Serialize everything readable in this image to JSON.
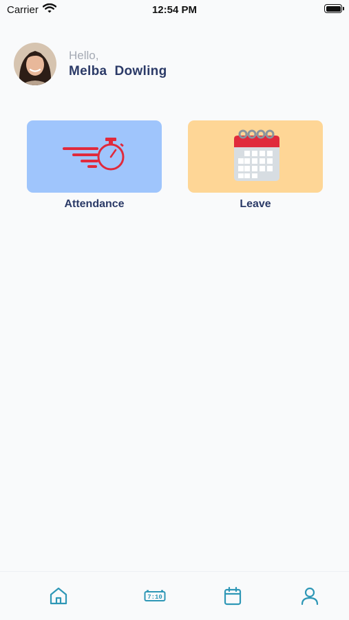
{
  "status_bar": {
    "carrier": "Carrier",
    "time": "12:54 PM"
  },
  "greeting": {
    "hello": "Hello,",
    "name": "Melba  Dowling"
  },
  "tiles": [
    {
      "label": "Attendance",
      "color": "#9fc5fc",
      "icon": "stopwatch-icon"
    },
    {
      "label": "Leave",
      "color": "#fed696",
      "icon": "calendar-icon"
    }
  ],
  "bottom_nav": {
    "items": [
      "home-icon",
      "attendance-clock-icon",
      "calendar-icon",
      "profile-icon"
    ],
    "clock_display": "7:10",
    "accent": "#2e97b6"
  },
  "colors": {
    "primary_text": "#2b3a67",
    "icon_red": "#e02a3c"
  }
}
